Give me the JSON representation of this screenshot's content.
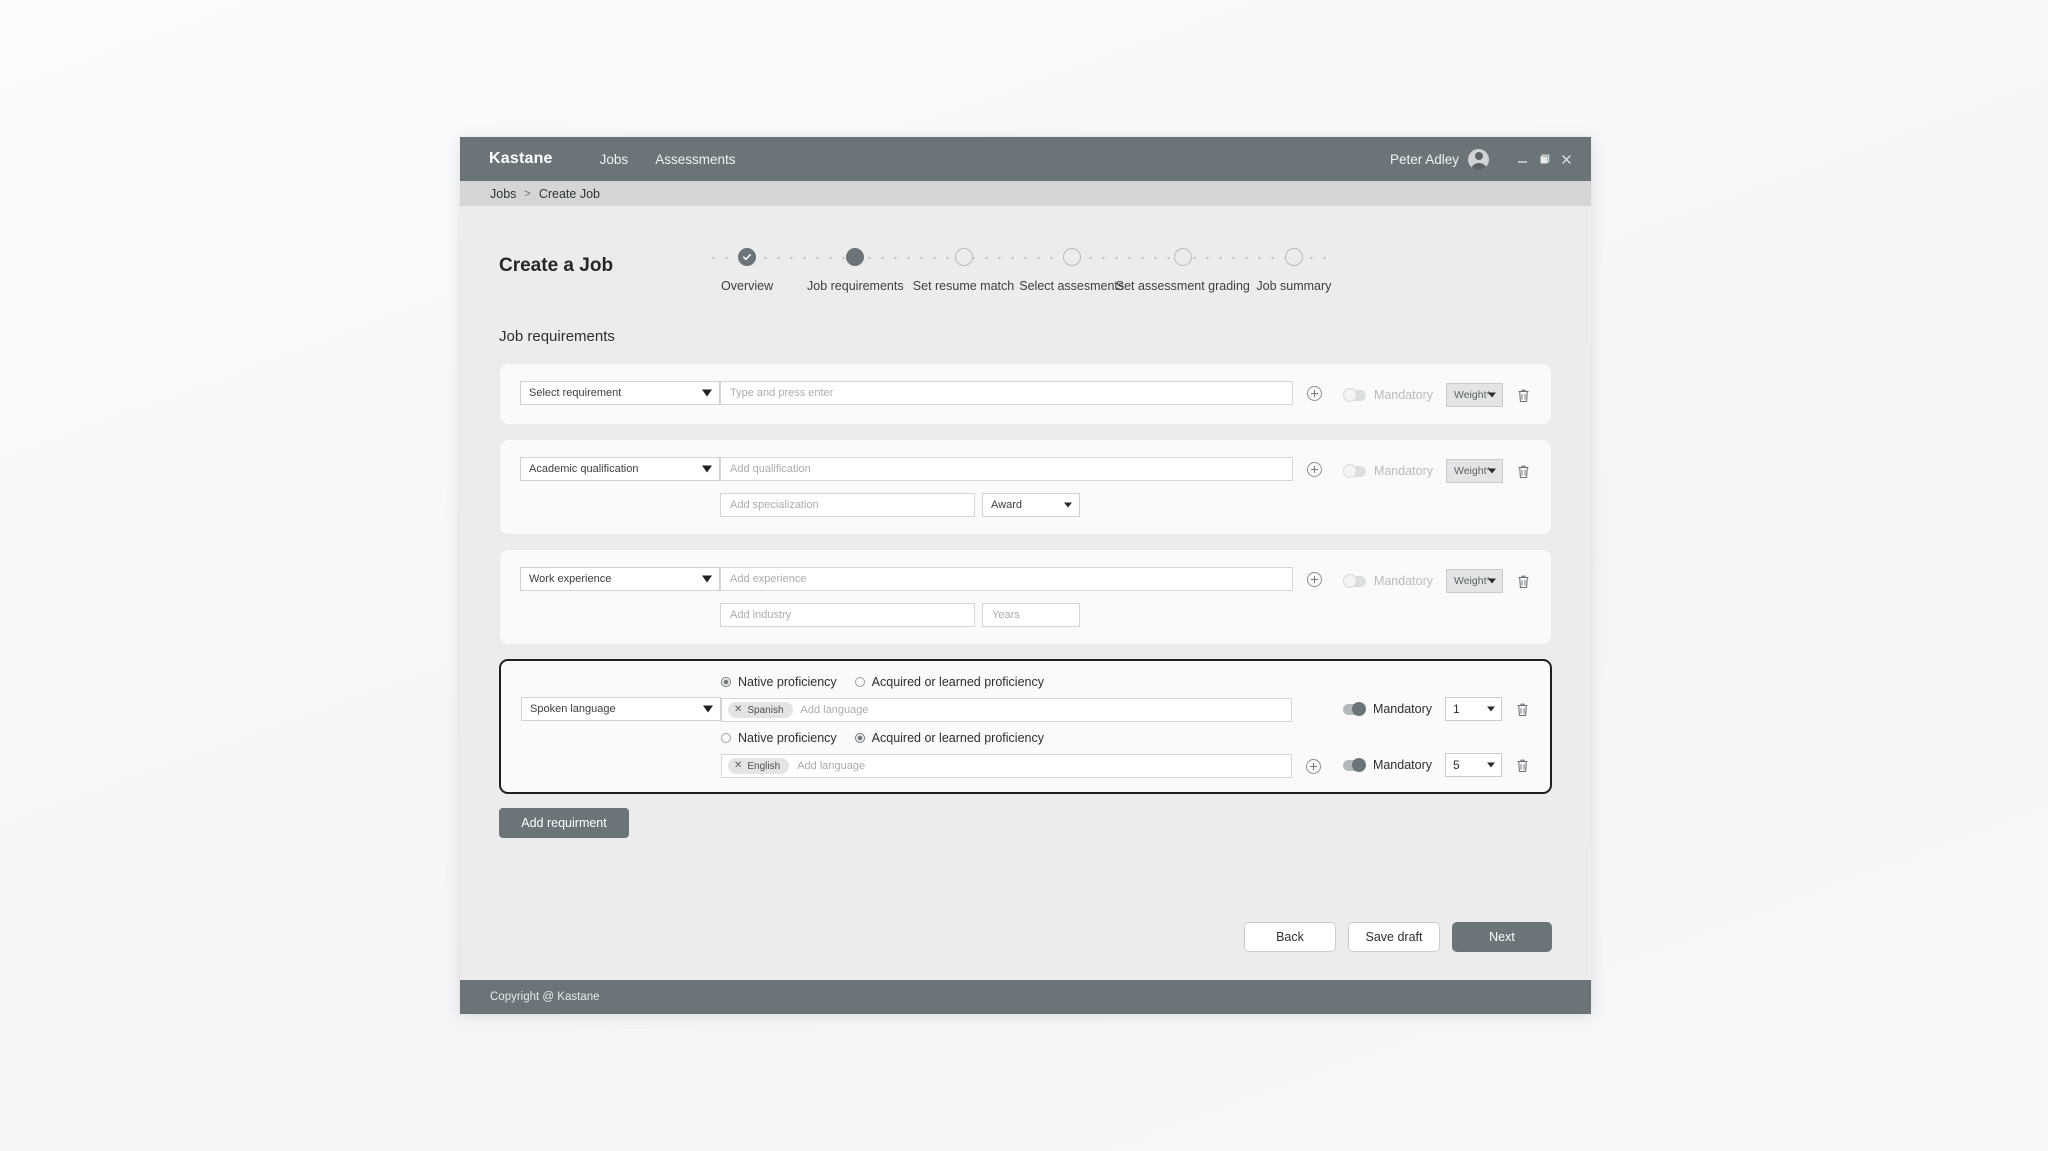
{
  "window": {
    "brand": "Kastane",
    "nav": [
      {
        "label": "Jobs"
      },
      {
        "label": "Assessments"
      }
    ],
    "user": "Peter Adley",
    "controls": {
      "minimize": "minimize-icon",
      "restore": "restore-icon",
      "close": "close-icon"
    }
  },
  "breadcrumb": {
    "parent": "Jobs",
    "separator": ">",
    "current": "Create Job"
  },
  "page": {
    "title": "Create a Job",
    "section_title": "Job requirements"
  },
  "stepper": {
    "steps": [
      {
        "label": "Overview",
        "state": "done"
      },
      {
        "label": "Job requirements",
        "state": "current"
      },
      {
        "label": "Set resume match",
        "state": "todo"
      },
      {
        "label": "Select assesments",
        "state": "todo"
      },
      {
        "label": "Set assessment grading",
        "state": "todo"
      },
      {
        "label": "Job summary",
        "state": "todo"
      }
    ]
  },
  "requirements": [
    {
      "type_value": "Select requirement",
      "main_placeholder": "Type and press enter",
      "mandatory_label": "Mandatory",
      "mandatory_on": false,
      "weight_value": "Weight*",
      "has_plus": true
    },
    {
      "type_value": "Academic qualification",
      "main_placeholder": "Add qualification",
      "sub_placeholder": "Add specialization",
      "sub_select_value": "Award",
      "mandatory_label": "Mandatory",
      "mandatory_on": false,
      "weight_value": "Weight*",
      "has_plus": true
    },
    {
      "type_value": "Work experience",
      "main_placeholder": "Add experience",
      "sub_placeholder": "Add industry",
      "sub_input_placeholder": "Years",
      "mandatory_label": "Mandatory",
      "mandatory_on": false,
      "weight_value": "Weight*",
      "has_plus": true
    }
  ],
  "language_card": {
    "type_value": "Spoken language",
    "selected": true,
    "radio_native_label": "Native proficiency",
    "radio_acquired_label": "Acquired or learned proficiency",
    "rows": [
      {
        "proficiency": "native",
        "chip": "Spanish",
        "chip_remove": "✕",
        "placeholder": "Add language",
        "has_plus": false,
        "mandatory_label": "Mandatory",
        "mandatory_on": true,
        "weight_value": "1"
      },
      {
        "proficiency": "acquired",
        "chip": "English",
        "chip_remove": "✕",
        "placeholder": "Add language",
        "has_plus": true,
        "mandatory_label": "Mandatory",
        "mandatory_on": true,
        "weight_value": "5"
      }
    ]
  },
  "actions": {
    "add_requirement": "Add requirment",
    "back": "Back",
    "save_draft": "Save draft",
    "next": "Next"
  },
  "footer": {
    "copyright": "Copyright @ Kastane"
  },
  "colors": {
    "accent": "#6b7478",
    "page_bg": "#ececec",
    "card_bg": "#fafafa",
    "selected_border": "#1d1f20",
    "crumb_bar": "#d3d5d6"
  }
}
